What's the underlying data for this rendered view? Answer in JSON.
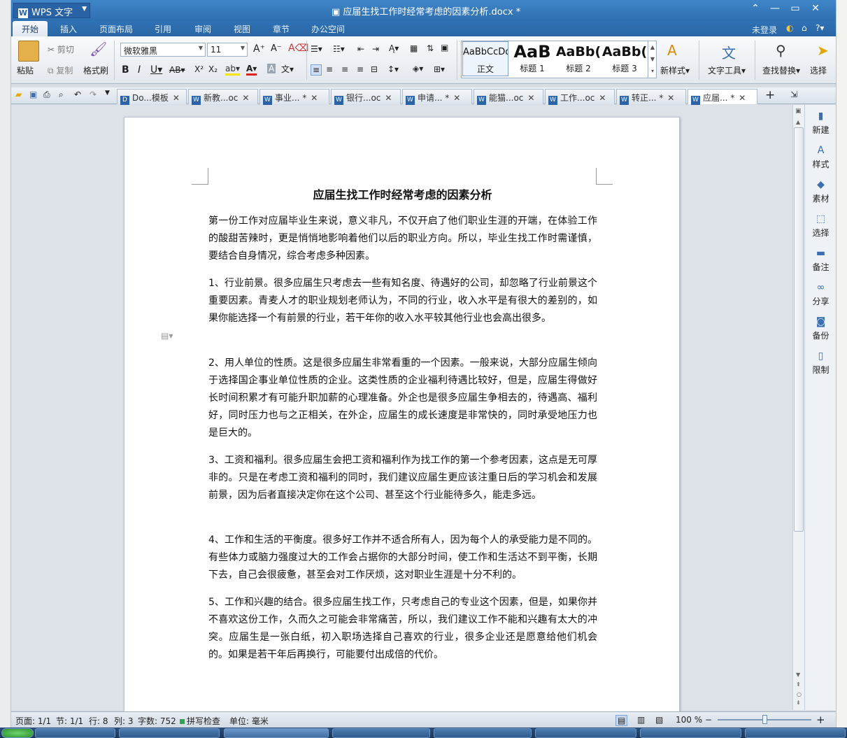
{
  "app": {
    "brand": "WPS 文字",
    "window_title": "应届生找工作时经常考虑的因素分析.docx *"
  },
  "menu": {
    "tabs": [
      "开始",
      "插入",
      "页面布局",
      "引用",
      "审阅",
      "视图",
      "章节",
      "办公空间"
    ],
    "active": "开始",
    "login": "未登录",
    "help": "?"
  },
  "ribbon": {
    "paste": "粘贴",
    "cut": "剪切",
    "copy": "复制",
    "format_painter": "格式刷",
    "font_name": "微软雅黑",
    "font_size": "11",
    "styles": [
      {
        "preview": "AaBbCcDd",
        "name": "正文"
      },
      {
        "preview": "AaB",
        "name": "标题 1"
      },
      {
        "preview": "AaBb(",
        "name": "标题 2"
      },
      {
        "preview": "AaBb(",
        "name": "标题 3"
      }
    ],
    "new_style": "新样式",
    "text_tools": "文字工具",
    "find_replace": "查找替换",
    "select": "选择"
  },
  "doc_tabs": [
    {
      "label": "Do...模板"
    },
    {
      "label": "新教...oc"
    },
    {
      "label": "事业... *"
    },
    {
      "label": "银行...oc"
    },
    {
      "label": "申请... *"
    },
    {
      "label": "能猫...oc"
    },
    {
      "label": "工作...oc"
    },
    {
      "label": "转正... *"
    },
    {
      "label": "应届... *"
    }
  ],
  "document": {
    "title": "应届生找工作时经常考虑的因素分析",
    "paragraphs": [
      "第一份工作对应届毕业生来说，意义非凡，不仅开启了他们职业生涯的开端，在体验工作的酸甜苦辣时，更是悄悄地影响着他们以后的职业方向。所以，毕业生找工作时需谨慎，要结合自身情况，综合考虑多种因素。",
      "1、行业前景。很多应届生只考虑去一些有知名度、待遇好的公司，却忽略了行业前景这个重要因素。青麦人才的职业规划老师认为，不同的行业，收入水平是有很大的差别的，如果你能选择一个有前景的行业，若干年你的收入水平较其他行业也会高出很多。",
      "2、用人单位的性质。这是很多应届生非常看重的一个因素。一般来说，大部分应届生倾向于选择国企事业单位性质的企业。这类性质的企业福利待遇比较好，但是，应届生得做好长时间积累才有可能升职加薪的心理准备。外企也是很多应届生争相去的，待遇高、福利好，同时压力也与之正相关，在外企，应届生的成长速度是非常快的，同时承受地压力也是巨大的。",
      "3、工资和福利。很多应届生会把工资和福利作为找工作的第一个参考因素，这点是无可厚非的。只是在考虑工资和福利的同时，我们建议应届生更应该注重日后的学习机会和发展前景，因为后者直接决定你在这个公司、甚至这个行业能待多久，能走多远。",
      "4、工作和生活的平衡度。很多好工作并不适合所有人，因为每个人的承受能力是不同的。有些体力或脑力强度过大的工作会占据你的大部分时间，使工作和生活达不到平衡，长期下去，自己会很疲惫，甚至会对工作厌烦，这对职业生涯是十分不利的。",
      "5、工作和兴趣的结合。很多应届生找工作，只考虑自己的专业这个因素，但是，如果你并不喜欢这份工作，久而久之可能会非常痛苦，所以，我们建议工作不能和兴趣有太大的冲突。应届生是一张白纸，初入职场选择自己喜欢的行业，很多企业还是愿意给他们机会的。如果是若干年后再换行，可能要付出成倍的代价。"
    ]
  },
  "side_panel": [
    "新建",
    "样式",
    "素材",
    "选择",
    "备注",
    "分享",
    "备份",
    "限制"
  ],
  "status": {
    "page": "页面: 1/1",
    "section": "节: 1/1",
    "row": "行: 8",
    "col": "列: 3",
    "words": "字数: 752",
    "spell": "拼写检查",
    "unit": "单位: 毫米",
    "zoom": "100 %"
  }
}
